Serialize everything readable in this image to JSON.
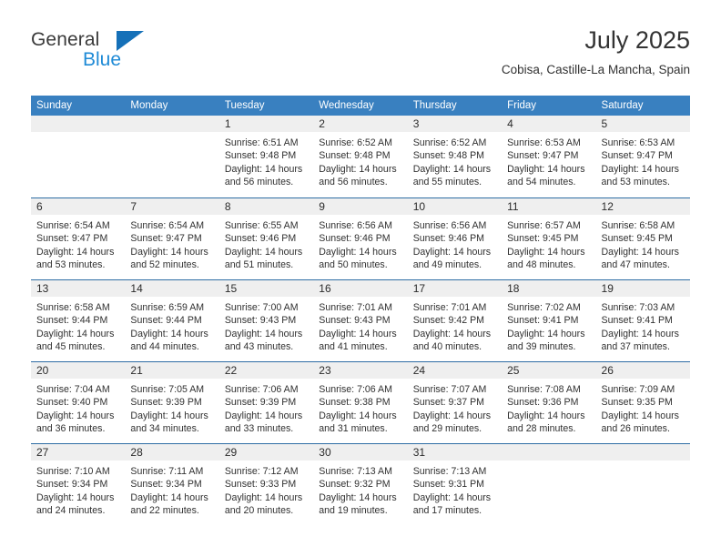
{
  "brand": {
    "word_one": "General",
    "word_two": "Blue",
    "triangle_icon": "brand-triangle-icon",
    "colors": {
      "general_text": "#3a3a3a",
      "blue_text": "#1e8ad6",
      "triangle": "#1570b8"
    }
  },
  "header": {
    "title": "July 2025",
    "subtitle": "Cobisa, Castille-La Mancha, Spain"
  },
  "calendar": {
    "accent_color": "#3980c0",
    "row_divider_color": "#2e6da4",
    "daynum_band_color": "#efefef",
    "weekdays": [
      "Sunday",
      "Monday",
      "Tuesday",
      "Wednesday",
      "Thursday",
      "Friday",
      "Saturday"
    ],
    "weeks": [
      [
        {
          "day": "",
          "lines": []
        },
        {
          "day": "",
          "lines": []
        },
        {
          "day": "1",
          "lines": [
            "Sunrise: 6:51 AM",
            "Sunset: 9:48 PM",
            "Daylight: 14 hours",
            "and 56 minutes."
          ]
        },
        {
          "day": "2",
          "lines": [
            "Sunrise: 6:52 AM",
            "Sunset: 9:48 PM",
            "Daylight: 14 hours",
            "and 56 minutes."
          ]
        },
        {
          "day": "3",
          "lines": [
            "Sunrise: 6:52 AM",
            "Sunset: 9:48 PM",
            "Daylight: 14 hours",
            "and 55 minutes."
          ]
        },
        {
          "day": "4",
          "lines": [
            "Sunrise: 6:53 AM",
            "Sunset: 9:47 PM",
            "Daylight: 14 hours",
            "and 54 minutes."
          ]
        },
        {
          "day": "5",
          "lines": [
            "Sunrise: 6:53 AM",
            "Sunset: 9:47 PM",
            "Daylight: 14 hours",
            "and 53 minutes."
          ]
        }
      ],
      [
        {
          "day": "6",
          "lines": [
            "Sunrise: 6:54 AM",
            "Sunset: 9:47 PM",
            "Daylight: 14 hours",
            "and 53 minutes."
          ]
        },
        {
          "day": "7",
          "lines": [
            "Sunrise: 6:54 AM",
            "Sunset: 9:47 PM",
            "Daylight: 14 hours",
            "and 52 minutes."
          ]
        },
        {
          "day": "8",
          "lines": [
            "Sunrise: 6:55 AM",
            "Sunset: 9:46 PM",
            "Daylight: 14 hours",
            "and 51 minutes."
          ]
        },
        {
          "day": "9",
          "lines": [
            "Sunrise: 6:56 AM",
            "Sunset: 9:46 PM",
            "Daylight: 14 hours",
            "and 50 minutes."
          ]
        },
        {
          "day": "10",
          "lines": [
            "Sunrise: 6:56 AM",
            "Sunset: 9:46 PM",
            "Daylight: 14 hours",
            "and 49 minutes."
          ]
        },
        {
          "day": "11",
          "lines": [
            "Sunrise: 6:57 AM",
            "Sunset: 9:45 PM",
            "Daylight: 14 hours",
            "and 48 minutes."
          ]
        },
        {
          "day": "12",
          "lines": [
            "Sunrise: 6:58 AM",
            "Sunset: 9:45 PM",
            "Daylight: 14 hours",
            "and 47 minutes."
          ]
        }
      ],
      [
        {
          "day": "13",
          "lines": [
            "Sunrise: 6:58 AM",
            "Sunset: 9:44 PM",
            "Daylight: 14 hours",
            "and 45 minutes."
          ]
        },
        {
          "day": "14",
          "lines": [
            "Sunrise: 6:59 AM",
            "Sunset: 9:44 PM",
            "Daylight: 14 hours",
            "and 44 minutes."
          ]
        },
        {
          "day": "15",
          "lines": [
            "Sunrise: 7:00 AM",
            "Sunset: 9:43 PM",
            "Daylight: 14 hours",
            "and 43 minutes."
          ]
        },
        {
          "day": "16",
          "lines": [
            "Sunrise: 7:01 AM",
            "Sunset: 9:43 PM",
            "Daylight: 14 hours",
            "and 41 minutes."
          ]
        },
        {
          "day": "17",
          "lines": [
            "Sunrise: 7:01 AM",
            "Sunset: 9:42 PM",
            "Daylight: 14 hours",
            "and 40 minutes."
          ]
        },
        {
          "day": "18",
          "lines": [
            "Sunrise: 7:02 AM",
            "Sunset: 9:41 PM",
            "Daylight: 14 hours",
            "and 39 minutes."
          ]
        },
        {
          "day": "19",
          "lines": [
            "Sunrise: 7:03 AM",
            "Sunset: 9:41 PM",
            "Daylight: 14 hours",
            "and 37 minutes."
          ]
        }
      ],
      [
        {
          "day": "20",
          "lines": [
            "Sunrise: 7:04 AM",
            "Sunset: 9:40 PM",
            "Daylight: 14 hours",
            "and 36 minutes."
          ]
        },
        {
          "day": "21",
          "lines": [
            "Sunrise: 7:05 AM",
            "Sunset: 9:39 PM",
            "Daylight: 14 hours",
            "and 34 minutes."
          ]
        },
        {
          "day": "22",
          "lines": [
            "Sunrise: 7:06 AM",
            "Sunset: 9:39 PM",
            "Daylight: 14 hours",
            "and 33 minutes."
          ]
        },
        {
          "day": "23",
          "lines": [
            "Sunrise: 7:06 AM",
            "Sunset: 9:38 PM",
            "Daylight: 14 hours",
            "and 31 minutes."
          ]
        },
        {
          "day": "24",
          "lines": [
            "Sunrise: 7:07 AM",
            "Sunset: 9:37 PM",
            "Daylight: 14 hours",
            "and 29 minutes."
          ]
        },
        {
          "day": "25",
          "lines": [
            "Sunrise: 7:08 AM",
            "Sunset: 9:36 PM",
            "Daylight: 14 hours",
            "and 28 minutes."
          ]
        },
        {
          "day": "26",
          "lines": [
            "Sunrise: 7:09 AM",
            "Sunset: 9:35 PM",
            "Daylight: 14 hours",
            "and 26 minutes."
          ]
        }
      ],
      [
        {
          "day": "27",
          "lines": [
            "Sunrise: 7:10 AM",
            "Sunset: 9:34 PM",
            "Daylight: 14 hours",
            "and 24 minutes."
          ]
        },
        {
          "day": "28",
          "lines": [
            "Sunrise: 7:11 AM",
            "Sunset: 9:34 PM",
            "Daylight: 14 hours",
            "and 22 minutes."
          ]
        },
        {
          "day": "29",
          "lines": [
            "Sunrise: 7:12 AM",
            "Sunset: 9:33 PM",
            "Daylight: 14 hours",
            "and 20 minutes."
          ]
        },
        {
          "day": "30",
          "lines": [
            "Sunrise: 7:13 AM",
            "Sunset: 9:32 PM",
            "Daylight: 14 hours",
            "and 19 minutes."
          ]
        },
        {
          "day": "31",
          "lines": [
            "Sunrise: 7:13 AM",
            "Sunset: 9:31 PM",
            "Daylight: 14 hours",
            "and 17 minutes."
          ]
        },
        {
          "day": "",
          "lines": []
        },
        {
          "day": "",
          "lines": []
        }
      ]
    ]
  }
}
